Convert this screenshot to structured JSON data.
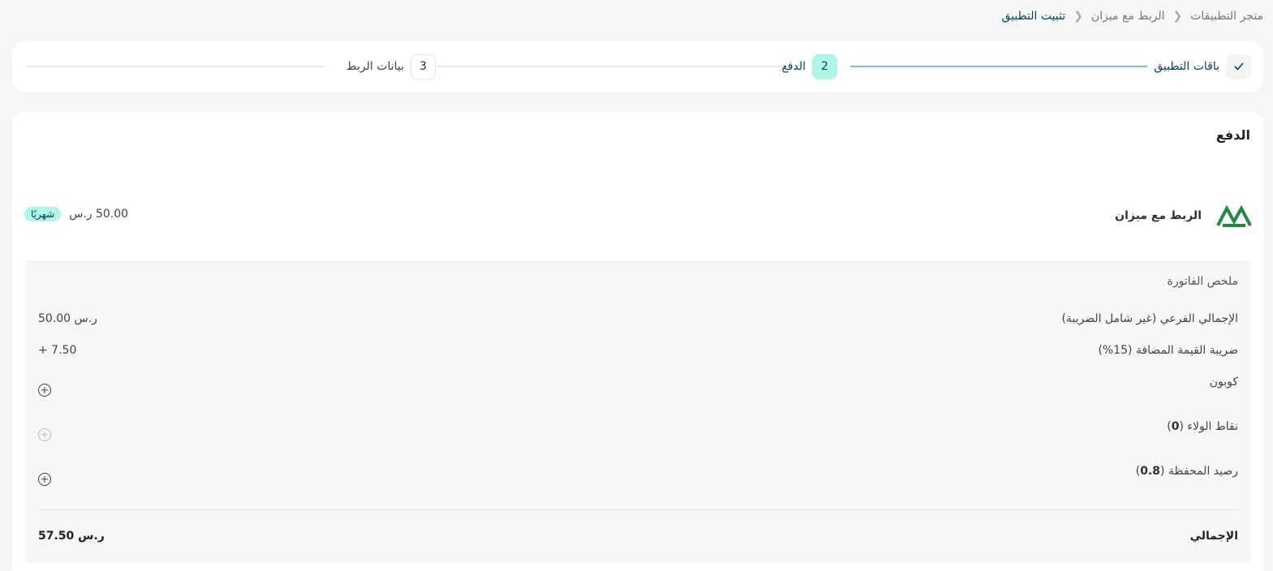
{
  "breadcrumb": {
    "items": [
      "متجر التطبيقات",
      "الربط مع ميزان",
      "تثبيت التطبيق"
    ]
  },
  "stepper": {
    "steps": [
      {
        "icon": "check-icon",
        "label": "باقات التطبيق",
        "status": "done"
      },
      {
        "number": "2",
        "label": "الدفع",
        "status": "active"
      },
      {
        "number": "3",
        "label": "بيانات الربط",
        "status": "pending"
      }
    ]
  },
  "card": {
    "title": "الدفع",
    "product": {
      "name": "الربط مع ميزان",
      "badge": "شهريًا",
      "price": "50.00 ر.س",
      "logo_icon": "mizan-logo-icon",
      "logo_color": "#1a8c3c"
    }
  },
  "invoice": {
    "title": "ملخص الفاتورة",
    "subtotal_label": "الإجمالي الفرعي (غير شامل الضريبة)",
    "subtotal_value": "50.00 ر.س",
    "vat_label": "ضريبة القيمة المضافة (15%)",
    "vat_value": "+ 7.50",
    "coupon_label": "كوبون",
    "loyalty_label": "نقاط الولاء",
    "loyalty_points": "0",
    "wallet_label": "رصيد المحفظة",
    "wallet_balance": "0.8",
    "total_label": "الإجمالي",
    "total_value": "57.50 ر.س"
  },
  "colors": {
    "accent": "#aef6e8",
    "primary_text": "#004956",
    "progress_line": "#5dd5c4"
  }
}
